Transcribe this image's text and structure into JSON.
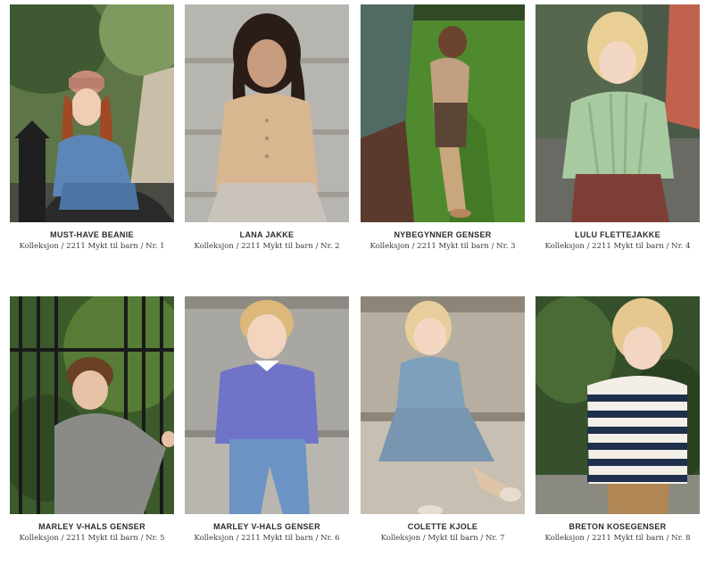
{
  "products": [
    {
      "title": "MUST-HAVE BEANIE",
      "subtitle": "Kolleksjon / 2211 Mykt til barn / Nr. 1",
      "photo_icon": "child-in-beanie-photo"
    },
    {
      "title": "LANA JAKKE",
      "subtitle": "Kolleksjon / 2211 Mykt til barn / Nr. 2",
      "photo_icon": "child-in-cardigan-photo"
    },
    {
      "title": "NYBEGYNNER GENSER",
      "subtitle": "Kolleksjon / 2211 Mykt til barn / Nr. 3",
      "photo_icon": "child-in-sweater-photo"
    },
    {
      "title": "LULU FLETTEJAKKE",
      "subtitle": "Kolleksjon / 2211 Mykt til barn / Nr. 4",
      "photo_icon": "child-in-cable-cardigan-photo"
    },
    {
      "title": "MARLEY V-HALS GENSER",
      "subtitle": "Kolleksjon / 2211 Mykt til barn / Nr. 5",
      "photo_icon": "child-in-grey-sweater-photo"
    },
    {
      "title": "MARLEY V-HALS GENSER",
      "subtitle": "Kolleksjon / 2211 Mykt til barn / Nr. 6",
      "photo_icon": "child-in-blue-sweater-photo"
    },
    {
      "title": "COLETTE KJOLE",
      "subtitle": "Kolleksjon / Mykt til barn / Nr. 7",
      "photo_icon": "child-in-dress-photo"
    },
    {
      "title": "BRETON KOSEGENSER",
      "subtitle": "Kolleksjon / 2211 Mykt til barn / Nr. 8",
      "photo_icon": "child-in-striped-sweater-photo"
    }
  ]
}
